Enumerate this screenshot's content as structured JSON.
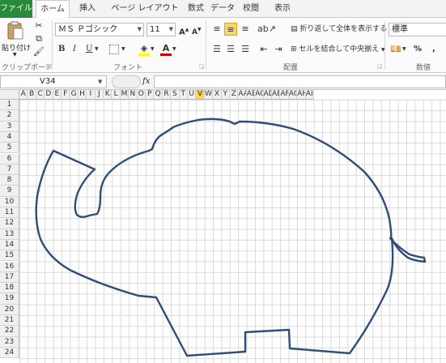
{
  "tabs": [
    "ファイル",
    "ホーム",
    "挿入",
    "ページ レイアウト",
    "数式",
    "データ",
    "校閲",
    "表示"
  ],
  "ribbon": {
    "clipboard": {
      "label": "クリップボード",
      "paste": "貼り付け"
    },
    "font": {
      "label": "フォント",
      "name": "ＭＳ Ｐゴシック",
      "size": "11",
      "bold": "B",
      "italic": "I",
      "underline": "U",
      "grow": "A",
      "shrink": "A",
      "font_color_letter": "A",
      "accent": "#c00000"
    },
    "alignment": {
      "label": "配置",
      "wrap": "折り返して全体を表示する",
      "merge": "セルを結合して中央揃え"
    },
    "number": {
      "label": "数値",
      "format": "標準",
      "percent": "%",
      "comma": ","
    }
  },
  "formula_bar": {
    "name_box": "V34",
    "fx": "fx",
    "value": ""
  },
  "columns": [
    "A",
    "B",
    "C",
    "D",
    "E",
    "F",
    "G",
    "H",
    "I",
    "J",
    "K",
    "L",
    "M",
    "N",
    "O",
    "P",
    "Q",
    "R",
    "S",
    "T",
    "U",
    "V",
    "W",
    "X",
    "Y",
    "Z",
    "AA",
    "AB",
    "AC",
    "AD",
    "AE",
    "AF",
    "AG",
    "AH",
    "AI"
  ],
  "selected_column": "V",
  "rows": [
    "1",
    "2",
    "3",
    "4",
    "5",
    "6",
    "7",
    "8",
    "9",
    "10",
    "11",
    "12",
    "13",
    "14",
    "15",
    "16",
    "17",
    "18",
    "19",
    "20",
    "21",
    "22",
    "23",
    "24"
  ],
  "drawing": {
    "shape": "elephant outline",
    "stroke": "#2f4e77"
  }
}
